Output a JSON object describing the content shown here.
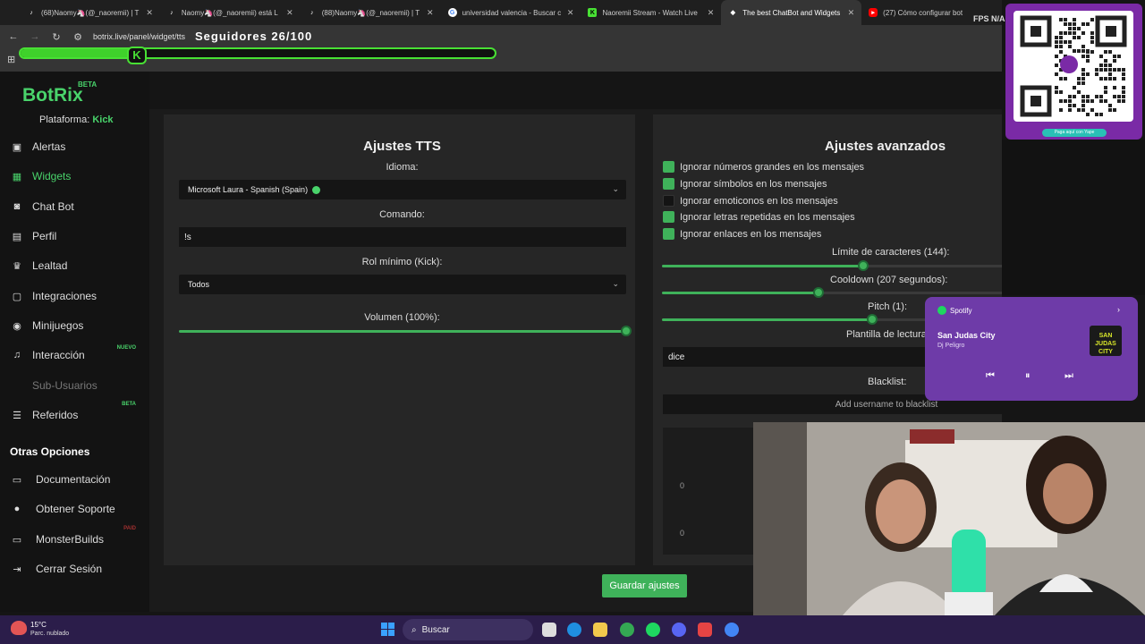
{
  "browser": {
    "tabs": [
      {
        "label": "(68)Naomy🦄(@_naoremii) | T",
        "icon": "tiktok-icon"
      },
      {
        "label": "Naomy🦄(@_naoremii) está L",
        "icon": "tiktok-icon"
      },
      {
        "label": "(88)Naomy🦄(@_naoremii) | T",
        "icon": "tiktok-icon"
      },
      {
        "label": "universidad valencia - Buscar c",
        "icon": "google-icon"
      },
      {
        "label": "Naoremii Stream - Watch Live",
        "icon": "kick-icon"
      },
      {
        "label": "The best ChatBot and Widgets",
        "icon": "botrix-icon"
      },
      {
        "label": "(27) Cómo configurar bot",
        "icon": "youtube-icon"
      }
    ],
    "fps_label": "FPS N/A",
    "url": "botrix.live/panel/widget/tts"
  },
  "overlay": {
    "followers_label": "Seguidores 26/100",
    "followers_progress": 0.26
  },
  "sidebar": {
    "logo": "BotRix",
    "logo_badge": "BETA",
    "platform_label": "Plataforma:",
    "platform_value": "Kick",
    "items": [
      {
        "label": "Alertas",
        "icon": "alert-icon"
      },
      {
        "label": "Widgets",
        "icon": "widgets-icon"
      },
      {
        "label": "Chat Bot",
        "icon": "robot-icon"
      },
      {
        "label": "Perfil",
        "icon": "profile-icon"
      },
      {
        "label": "Lealtad",
        "icon": "trophy-icon"
      },
      {
        "label": "Integraciones",
        "icon": "integrations-icon"
      },
      {
        "label": "Minijuegos",
        "icon": "gamepad-icon"
      },
      {
        "label": "Interacción",
        "icon": "music-icon",
        "badge": "NUEVO"
      },
      {
        "label": "Sub-Usuarios",
        "icon": "users-icon"
      },
      {
        "label": "Referidos",
        "icon": "referral-icon",
        "badge": "BETA"
      }
    ],
    "other_title": "Otras Opciones",
    "other_items": [
      {
        "label": "Documentación",
        "icon": "document-icon"
      },
      {
        "label": "Obtener Soporte",
        "icon": "support-icon"
      },
      {
        "label": "MonsterBuilds",
        "icon": "monitor-icon",
        "badge": "PAID"
      },
      {
        "label": "Cerrar Sesión",
        "icon": "logout-icon"
      }
    ]
  },
  "tts": {
    "title": "Ajustes TTS",
    "language_label": "Idioma:",
    "language_value": "Microsoft Laura - Spanish (Spain)",
    "command_label": "Comando:",
    "command_value": "!s",
    "role_label": "Rol mínimo (Kick):",
    "role_value": "Todos",
    "volume_label": "Volumen (100%):",
    "volume_value": 1.0
  },
  "advanced": {
    "title": "Ajustes avanzados",
    "options": [
      {
        "label": "Ignorar números grandes en los mensajes",
        "checked": true
      },
      {
        "label": "Ignorar símbolos en los mensajes",
        "checked": true
      },
      {
        "label": "Ignorar emoticonos en los mensajes",
        "checked": false
      },
      {
        "label": "Ignorar letras repetidas en los mensajes",
        "checked": true
      },
      {
        "label": "Ignorar enlaces en los mensajes",
        "checked": true
      }
    ],
    "char_limit_label": "Límite de caracteres (144):",
    "char_limit_value": 0.45,
    "cooldown_label": "Cooldown (207 segundos):",
    "cooldown_value": 0.35,
    "pitch_label": "Pitch (1):",
    "pitch_value": 0.47,
    "template_label": "Plantilla de lectura",
    "template_value": "dice",
    "blacklist_label": "Blacklist:",
    "blacklist_placeholder": "Add username to blacklist",
    "counters": [
      "0",
      "0"
    ]
  },
  "save_label": "Guardar ajustes",
  "qr": {
    "caption": "Paga aquí con Yape"
  },
  "spotify": {
    "app": "Spotify",
    "song": "San Judas City",
    "artist": "Dj Peligro",
    "cover_text": "SAN JUDAS CITY"
  },
  "taskbar": {
    "temperature": "15°C",
    "weather": "Parc. nublado",
    "search_label": "Buscar"
  }
}
